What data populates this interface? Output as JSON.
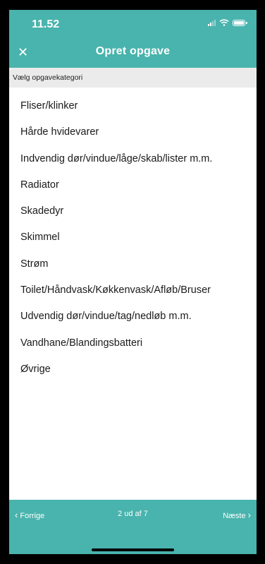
{
  "status_bar": {
    "time": "11.52"
  },
  "header": {
    "close_label": "✕",
    "title": "Opret opgave"
  },
  "section": {
    "label": "Vælg opgavekategori"
  },
  "categories": [
    "Fliser/klinker",
    "Hårde hvidevarer",
    "Indvendig dør/vindue/låge/skab/lister m.m.",
    "Radiator",
    "Skadedyr",
    "Skimmel",
    "Strøm",
    "Toilet/Håndvask/Køkkenvask/Afløb/Bruser",
    "Udvendig dør/vindue/tag/nedløb m.m.",
    "Vandhane/Blandingsbatteri",
    "Øvrige"
  ],
  "footer": {
    "prev_label": "Forrige",
    "pager_text": "2 ud af 7",
    "next_label": "Næste"
  },
  "colors": {
    "accent": "#49b3ad",
    "section_bg": "#ebebeb"
  }
}
